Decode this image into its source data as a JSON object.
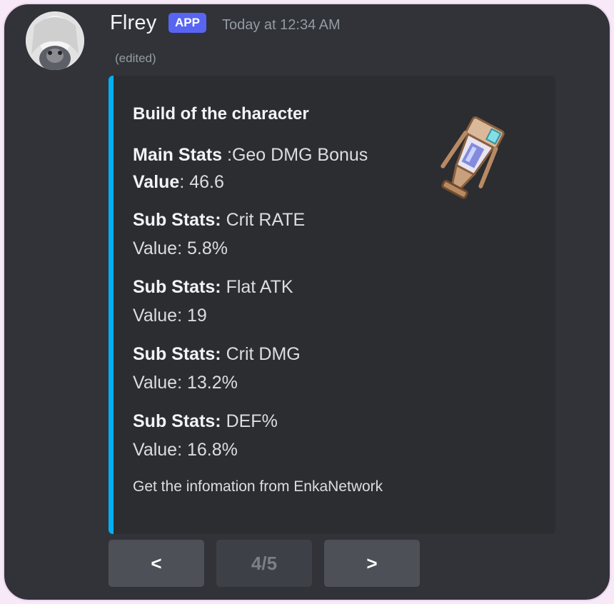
{
  "message": {
    "username": "Flrey",
    "badge": "APP",
    "timestamp": "Today at 12:34 AM",
    "edited": "(edited)"
  },
  "embed": {
    "accent_color": "#00b0f4",
    "title": "Build of the character",
    "main_stats": {
      "label": "Main Stats",
      "separator": " :",
      "value": "Geo DMG Bonus",
      "value_label": "Value",
      "value_text": ": 46.6"
    },
    "sub_stats": [
      {
        "label": "Sub Stats:",
        "name": " Crit RATE",
        "value": "Value: 5.8%"
      },
      {
        "label": "Sub Stats:",
        "name": " Flat ATK",
        "value": "Value: 19"
      },
      {
        "label": "Sub Stats:",
        "name": " Crit DMG",
        "value": "Value: 13.2%"
      },
      {
        "label": "Sub Stats:",
        "name": " DEF%",
        "value": "Value: 16.8%"
      }
    ],
    "footer": "Get the infomation from EnkaNetwork",
    "thumbnail_icon": "artifact-goblet-icon"
  },
  "pagination": {
    "prev_label": "<",
    "page_label": "4/5",
    "next_label": ">"
  }
}
